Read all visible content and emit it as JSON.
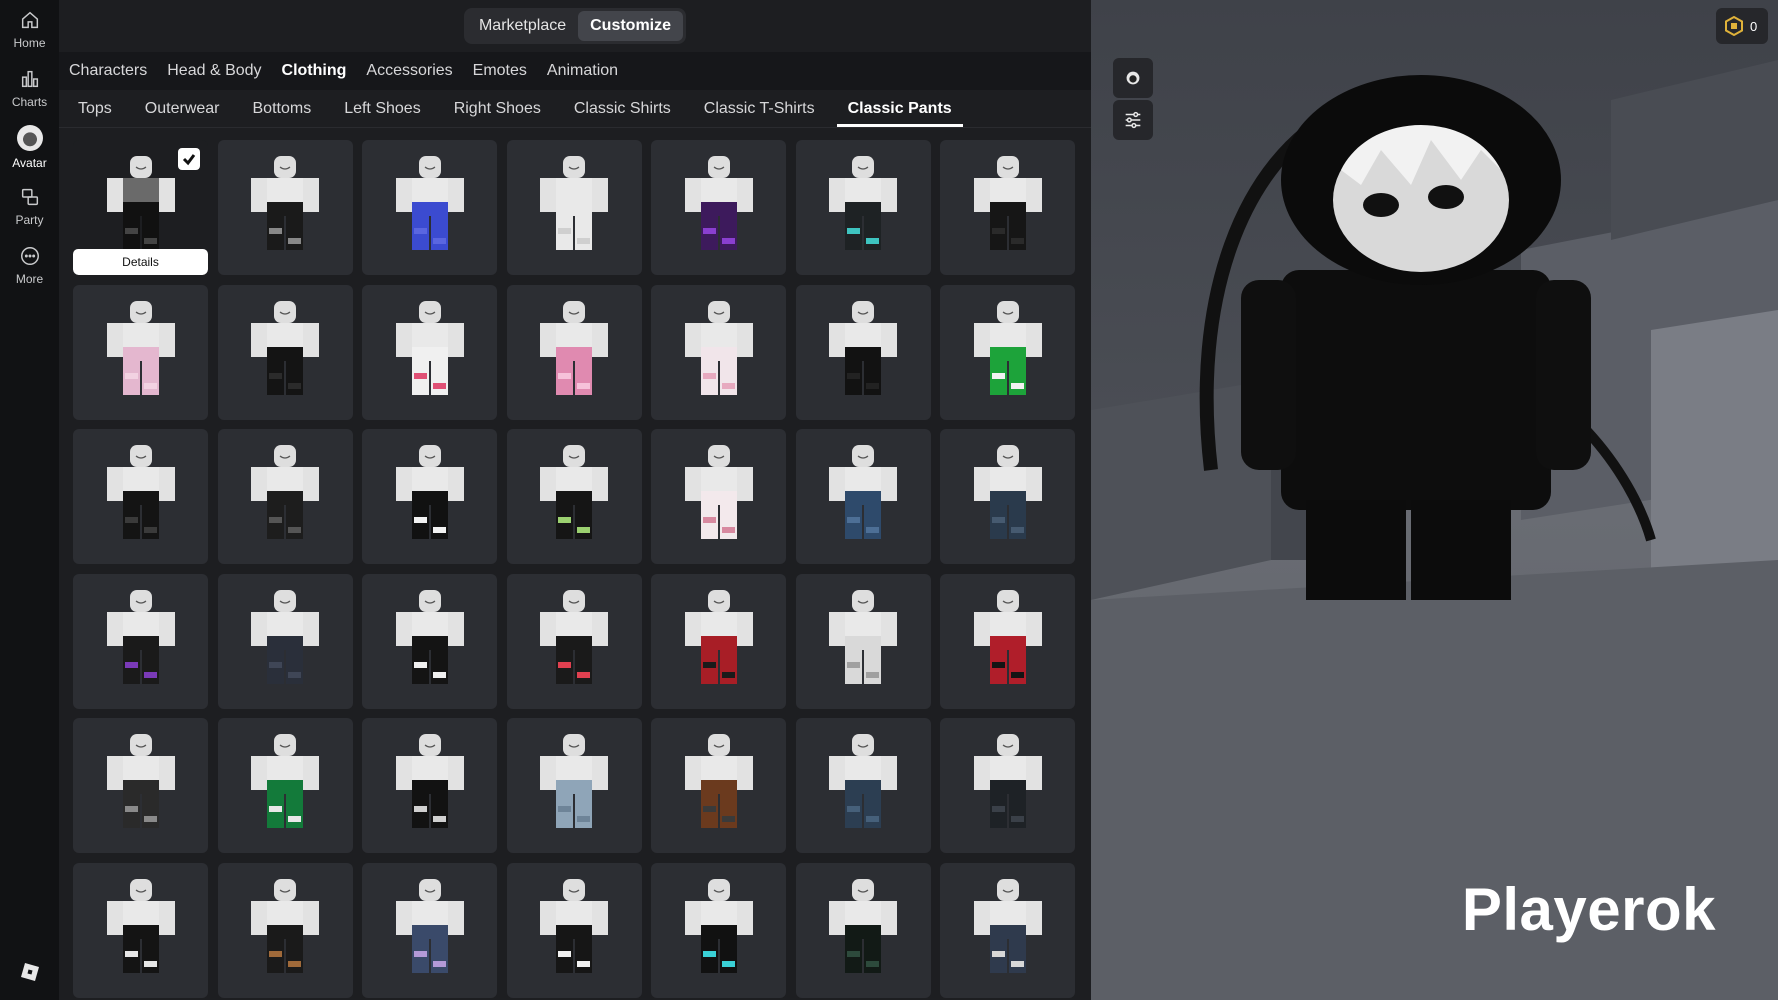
{
  "nav": {
    "items": [
      {
        "label": "Home",
        "icon": "home-icon"
      },
      {
        "label": "Charts",
        "icon": "charts-icon"
      },
      {
        "label": "Avatar",
        "icon": "avatar-icon"
      },
      {
        "label": "Party",
        "icon": "party-icon"
      },
      {
        "label": "More",
        "icon": "more-icon"
      }
    ],
    "active": "Avatar"
  },
  "mode_tabs": [
    {
      "label": "Marketplace",
      "active": false
    },
    {
      "label": "Customize",
      "active": true
    }
  ],
  "categories": [
    {
      "label": "Characters",
      "active": false
    },
    {
      "label": "Head & Body",
      "active": false
    },
    {
      "label": "Clothing",
      "active": true
    },
    {
      "label": "Accessories",
      "active": false
    },
    {
      "label": "Emotes",
      "active": false
    },
    {
      "label": "Animation",
      "active": false
    }
  ],
  "subcategories": [
    {
      "label": "Tops",
      "active": false
    },
    {
      "label": "Outerwear",
      "active": false
    },
    {
      "label": "Bottoms",
      "active": false
    },
    {
      "label": "Left Shoes",
      "active": false
    },
    {
      "label": "Right Shoes",
      "active": false
    },
    {
      "label": "Classic Shirts",
      "active": false
    },
    {
      "label": "Classic T-Shirts",
      "active": false
    },
    {
      "label": "Classic Pants",
      "active": true
    }
  ],
  "selected_item": {
    "details_label": "Details"
  },
  "items": [
    {
      "pants": "#111111",
      "accent": "#444444",
      "torso": "#6a6a6a",
      "selected": true
    },
    {
      "pants": "#1a1a1a",
      "accent": "#888888"
    },
    {
      "pants": "#3b4bd0",
      "accent": "#5a66e0"
    },
    {
      "pants": "#e9e9e9",
      "accent": "#cfcfcf"
    },
    {
      "pants": "#3d1a5c",
      "accent": "#8a3fd0"
    },
    {
      "pants": "#1e2224",
      "accent": "#3ec4c0"
    },
    {
      "pants": "#161616",
      "accent": "#2a2a2a"
    },
    {
      "pants": "#e4b7cf",
      "accent": "#f2d2e2"
    },
    {
      "pants": "#141414",
      "accent": "#2b2b2b"
    },
    {
      "pants": "#f0f0f0",
      "accent": "#e05075"
    },
    {
      "pants": "#e08ab0",
      "accent": "#f6c2da"
    },
    {
      "pants": "#f1e5ea",
      "accent": "#e7a9bf"
    },
    {
      "pants": "#121212",
      "accent": "#222222"
    },
    {
      "pants": "#1da33a",
      "accent": "#f2f2f2"
    },
    {
      "pants": "#141414",
      "accent": "#3a3a3a"
    },
    {
      "pants": "#1d1d1d",
      "accent": "#555555"
    },
    {
      "pants": "#111111",
      "accent": "#f2f2f2"
    },
    {
      "pants": "#151515",
      "accent": "#9bd070"
    },
    {
      "pants": "#f3e9ec",
      "accent": "#d889a0"
    },
    {
      "pants": "#2e4a6b",
      "accent": "#4d6f96"
    },
    {
      "pants": "#2a3a4c",
      "accent": "#465a70"
    },
    {
      "pants": "#1a1a1a",
      "accent": "#7a3ab8"
    },
    {
      "pants": "#2a2f3a",
      "accent": "#3f4656"
    },
    {
      "pants": "#141414",
      "accent": "#f0f0f0"
    },
    {
      "pants": "#1a1a1a",
      "accent": "#e04050"
    },
    {
      "pants": "#a81e26",
      "accent": "#1a1a1a"
    },
    {
      "pants": "#d9d9d9",
      "accent": "#a0a0a0"
    },
    {
      "pants": "#b01e2a",
      "accent": "#141414"
    },
    {
      "pants": "#2a2a2a",
      "accent": "#8a8a8a"
    },
    {
      "pants": "#137a3a",
      "accent": "#e8e8e8"
    },
    {
      "pants": "#121212",
      "accent": "#d0d0d0"
    },
    {
      "pants": "#8fa5b8",
      "accent": "#6e8498"
    },
    {
      "pants": "#6b3a1e",
      "accent": "#3a3a3a"
    },
    {
      "pants": "#2c3e52",
      "accent": "#46607a"
    },
    {
      "pants": "#1e2226",
      "accent": "#3a4048"
    },
    {
      "pants": "#141414",
      "accent": "#e6e6e6"
    },
    {
      "pants": "#1a1a1a",
      "accent": "#a06a3a"
    },
    {
      "pants": "#3a4a6a",
      "accent": "#b49ad8"
    },
    {
      "pants": "#161616",
      "accent": "#f2f2f2"
    },
    {
      "pants": "#111111",
      "accent": "#3ad0d6"
    },
    {
      "pants": "#121a16",
      "accent": "#2d4a3c"
    },
    {
      "pants": "#2f3a4d",
      "accent": "#d8d8d8"
    }
  ],
  "preview": {
    "username": "Playerok",
    "robux_count": "0"
  },
  "colors": {
    "background": "#1d1e21",
    "card": "#2c2e33",
    "rail": "#111214",
    "scene": "#4b4e55"
  }
}
